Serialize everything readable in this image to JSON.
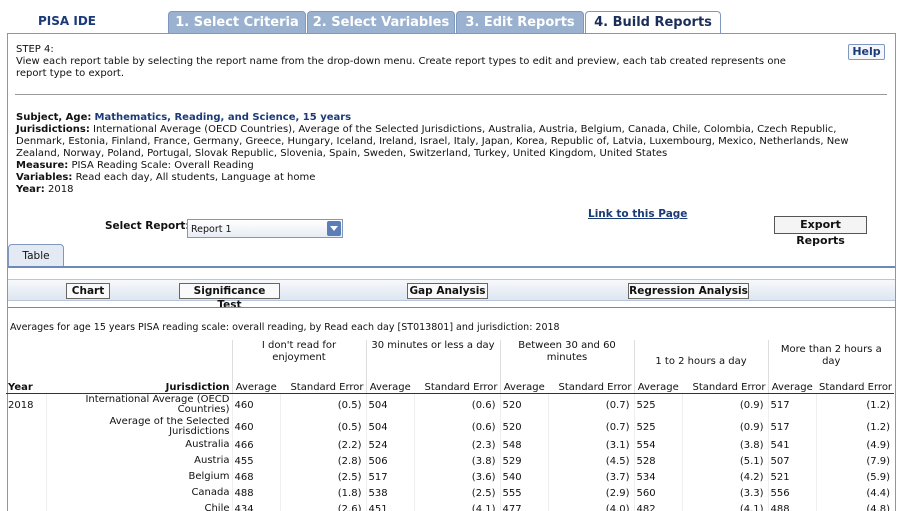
{
  "app": {
    "logo": "PISA IDE"
  },
  "tabs": [
    {
      "label": "1. Select Criteria"
    },
    {
      "label": "2. Select Variables"
    },
    {
      "label": "3. Edit Reports"
    },
    {
      "label": "4. Build Reports"
    }
  ],
  "step": {
    "title": "STEP 4:",
    "description": "View each report table by selecting the report name from the drop-down menu. Create report types to edit and preview, each tab created represents one report type to export.",
    "help_label": "Help"
  },
  "criteria": {
    "subject_label": "Subject, Age:",
    "subject_value": "Mathematics, Reading, and Science, 15 years",
    "jurisdictions_label": "Jurisdictions:",
    "jurisdictions_value": "International Average (OECD Countries), Average of the Selected Jurisdictions, Australia, Austria, Belgium, Canada, Chile, Colombia, Czech Republic, Denmark, Estonia, Finland, France, Germany, Greece, Hungary, Iceland, Ireland, Israel, Italy, Japan, Korea, Republic of, Latvia, Luxembourg, Mexico, Netherlands, New Zealand, Norway, Poland, Portugal, Slovak Republic, Slovenia, Spain, Sweden, Switzerland, Turkey, United Kingdom, United States",
    "measure_label": "Measure:",
    "measure_value": "PISA Reading Scale: Overall Reading",
    "variables_label": "Variables:",
    "variables_value": "Read each day, All students, Language at home",
    "year_label": "Year:",
    "year_value": "2018"
  },
  "report_select": {
    "label": "Select Report:",
    "value": "Report 1"
  },
  "link_label": "Link to this Page",
  "export_label": "Export Reports",
  "subtab_label": "Table",
  "buttons": {
    "chart": "Chart",
    "significance": "Significance Test",
    "gap": "Gap Analysis",
    "regression": "Regression Analysis"
  },
  "table": {
    "caption": "Averages for age 15 years PISA reading scale: overall reading, by Read each day [ST013801] and jurisdiction: 2018",
    "groups": [
      "I don't read for enjoyment",
      "30 minutes or less a day",
      "Between 30 and 60 minutes",
      "1 to 2 hours a day",
      "More than 2 hours a day"
    ],
    "col_year": "Year",
    "col_jurisdiction": "Jurisdiction",
    "col_average": "Average",
    "col_se": "Standard Error",
    "year": "2018",
    "rows": [
      {
        "name": "International Average (OECD Countries)",
        "v": [
          "460",
          "(0.5)",
          "504",
          "(0.6)",
          "520",
          "(0.7)",
          "525",
          "(0.9)",
          "517",
          "(1.2)"
        ]
      },
      {
        "name": "Average of the Selected Jurisdictions",
        "v": [
          "460",
          "(0.5)",
          "504",
          "(0.6)",
          "520",
          "(0.7)",
          "525",
          "(0.9)",
          "517",
          "(1.2)"
        ]
      },
      {
        "name": "Australia",
        "v": [
          "466",
          "(2.2)",
          "524",
          "(2.3)",
          "548",
          "(3.1)",
          "554",
          "(3.8)",
          "541",
          "(4.9)"
        ]
      },
      {
        "name": "Austria",
        "v": [
          "455",
          "(2.8)",
          "506",
          "(3.8)",
          "529",
          "(4.5)",
          "528",
          "(5.1)",
          "507",
          "(7.9)"
        ]
      },
      {
        "name": "Belgium",
        "v": [
          "468",
          "(2.5)",
          "517",
          "(3.6)",
          "540",
          "(3.7)",
          "534",
          "(4.2)",
          "521",
          "(5.9)"
        ]
      },
      {
        "name": "Canada",
        "v": [
          "488",
          "(1.8)",
          "538",
          "(2.5)",
          "555",
          "(2.9)",
          "560",
          "(3.3)",
          "556",
          "(4.4)"
        ]
      },
      {
        "name": "Chile",
        "v": [
          "434",
          "(2.6)",
          "451",
          "(4.1)",
          "477",
          "(4.0)",
          "482",
          "(4.1)",
          "488",
          "(4.8)"
        ]
      }
    ]
  }
}
